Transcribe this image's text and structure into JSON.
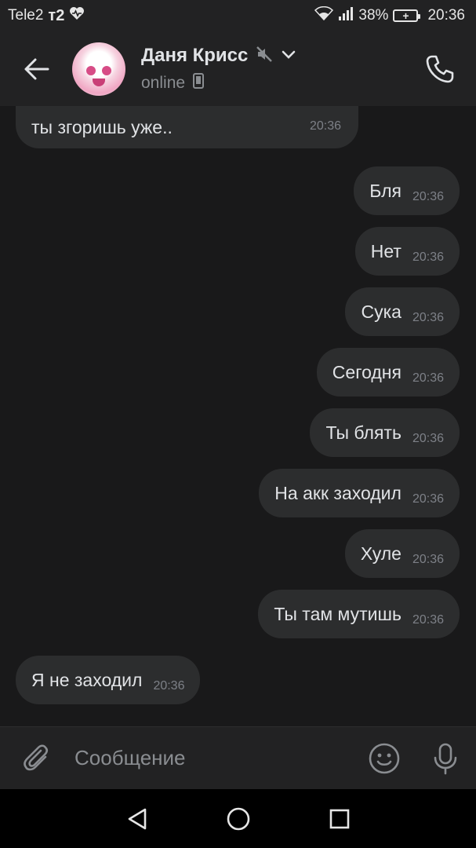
{
  "status_bar": {
    "carrier": "Tele2",
    "carrier_badge": "т2",
    "battery": "38%",
    "time": "20:36"
  },
  "header": {
    "name": "Даня Крисс",
    "status": "online"
  },
  "messages": [
    {
      "text": "ты згоришь уже..",
      "time": "20:36",
      "side": "in"
    },
    {
      "text": "Бля",
      "time": "20:36",
      "side": "out"
    },
    {
      "text": "Нет",
      "time": "20:36",
      "side": "out"
    },
    {
      "text": "Сука",
      "time": "20:36",
      "side": "out"
    },
    {
      "text": "Сегодня",
      "time": "20:36",
      "side": "out"
    },
    {
      "text": "Ты блять",
      "time": "20:36",
      "side": "out"
    },
    {
      "text": "На акк заходил",
      "time": "20:36",
      "side": "out"
    },
    {
      "text": "Хуле",
      "time": "20:36",
      "side": "out"
    },
    {
      "text": "Ты там мутишь",
      "time": "20:36",
      "side": "out"
    },
    {
      "text": "Я не заходил",
      "time": "20:36",
      "side": "in"
    }
  ],
  "composer": {
    "placeholder": "Сообщение"
  },
  "colors": {
    "background": "#19191a",
    "bar": "#222223",
    "bubble": "#2c2d2e",
    "text": "#e1e3e6",
    "muted": "#8a8d91"
  }
}
